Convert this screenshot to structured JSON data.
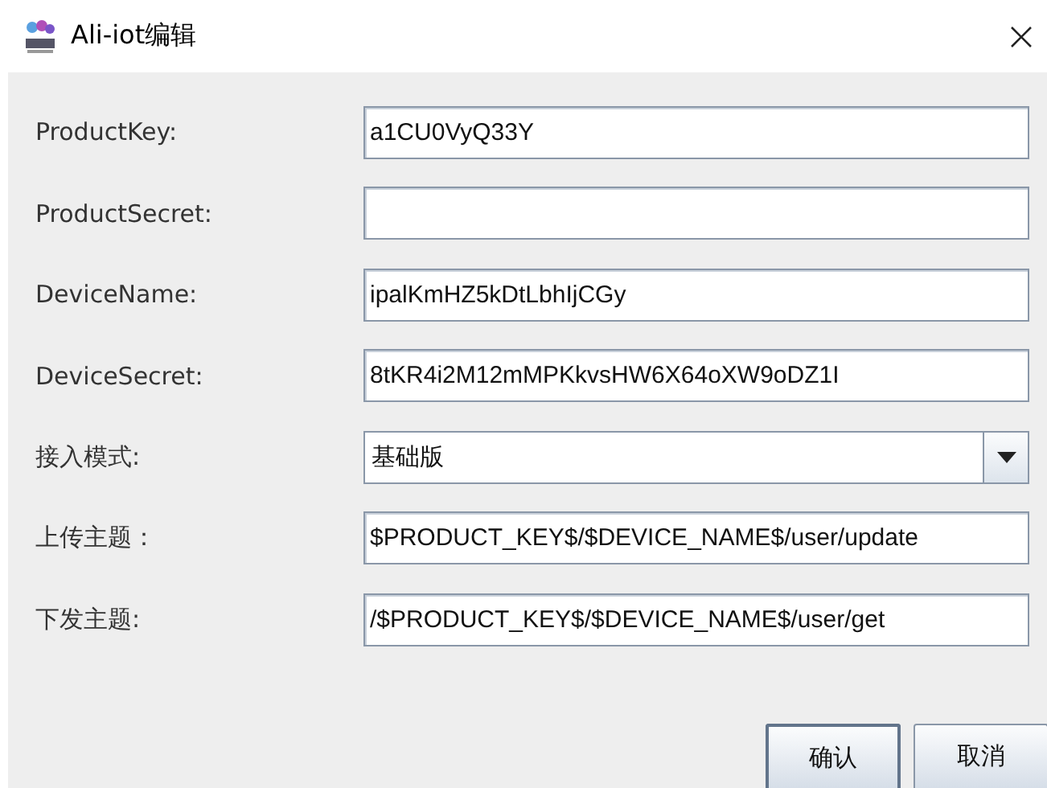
{
  "window": {
    "title": "Ali-iot编辑"
  },
  "fields": [
    {
      "kind": "text",
      "label": "ProductKey:",
      "value": "a1CU0VyQ33Y"
    },
    {
      "kind": "text",
      "label": "ProductSecret:"
    },
    {
      "kind": "text",
      "label": "DeviceName:",
      "value": "ipalKmHZ5kDtLbhIjCGy"
    },
    {
      "kind": "text",
      "label": "DeviceSecret:",
      "value": "8tKR4i2M12mMPKkvsHW6X64oXW9oDZ1I"
    },
    {
      "kind": "combo",
      "label": "接入模式:",
      "value": "基础版"
    },
    {
      "kind": "text",
      "label": "上传主题：",
      "value": "$PRODUCT_KEY$/$DEVICE_NAME$/user/update"
    },
    {
      "kind": "text",
      "label": "下发主题:",
      "value": "/$PRODUCT_KEY$/$DEVICE_NAME$/user/get"
    }
  ],
  "buttons": [
    {
      "label": "确认",
      "default": true
    },
    {
      "label": "取消",
      "default": false
    }
  ]
}
